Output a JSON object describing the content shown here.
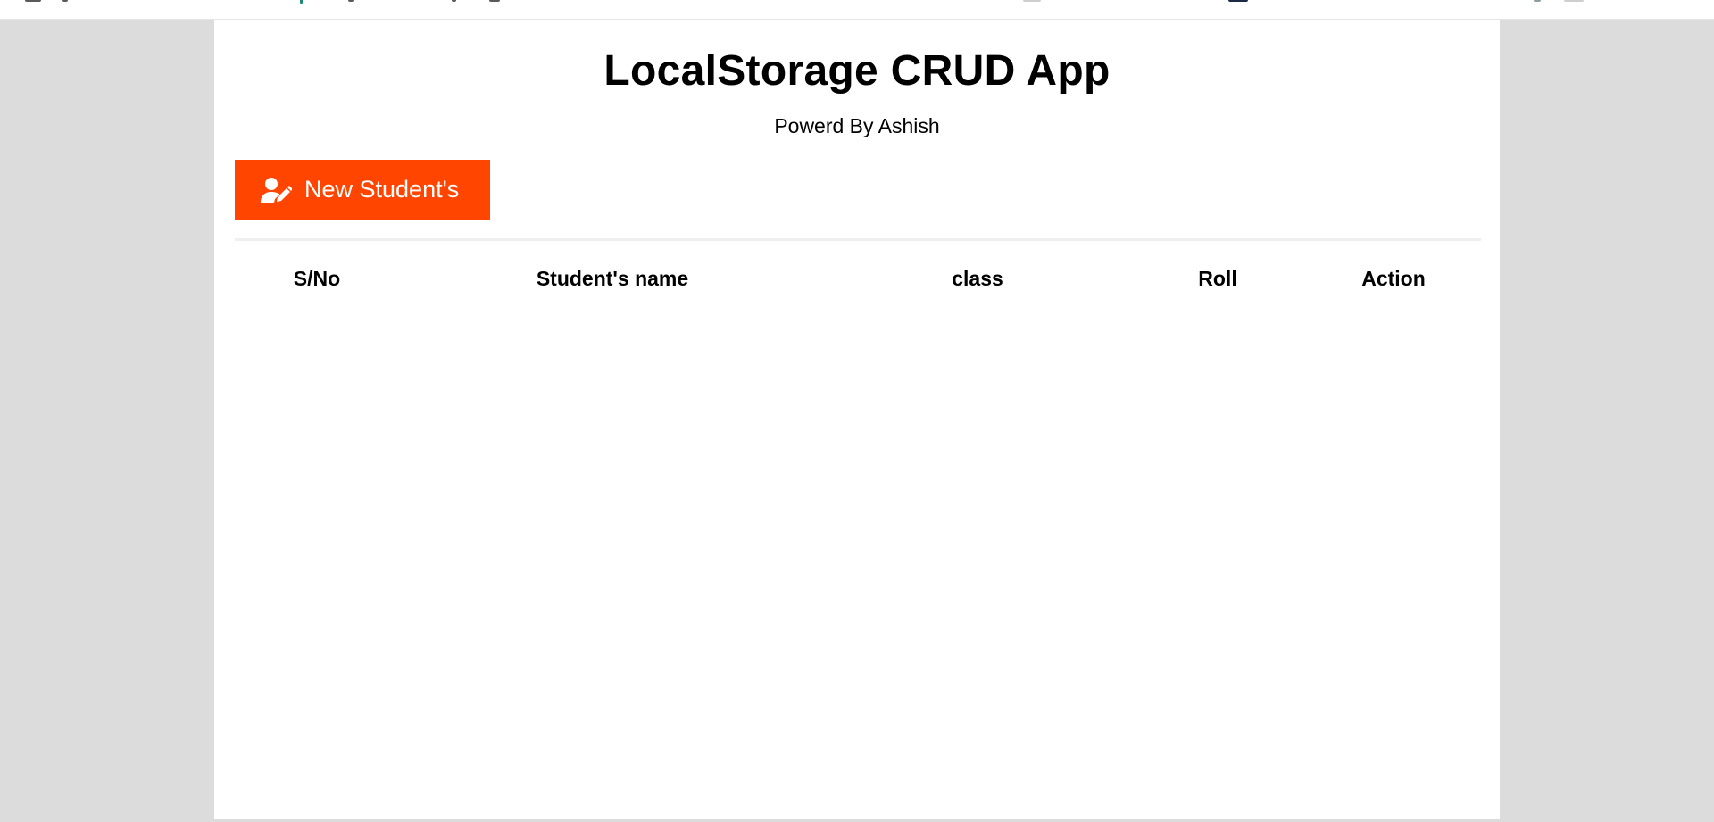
{
  "app": {
    "title": "LocalStorage CRUD App",
    "subtitle": "Powerd By Ashish"
  },
  "toolbar": {
    "new_button_label": "New Student's",
    "new_button_icon": "user-edit-icon"
  },
  "table": {
    "columns": [
      "S/No",
      "Student's name",
      "class",
      "Roll",
      "Action"
    ],
    "rows": []
  },
  "colors": {
    "accent": "#ff4500",
    "page_background": "#dcdcdc",
    "content_background": "#ffffff"
  }
}
